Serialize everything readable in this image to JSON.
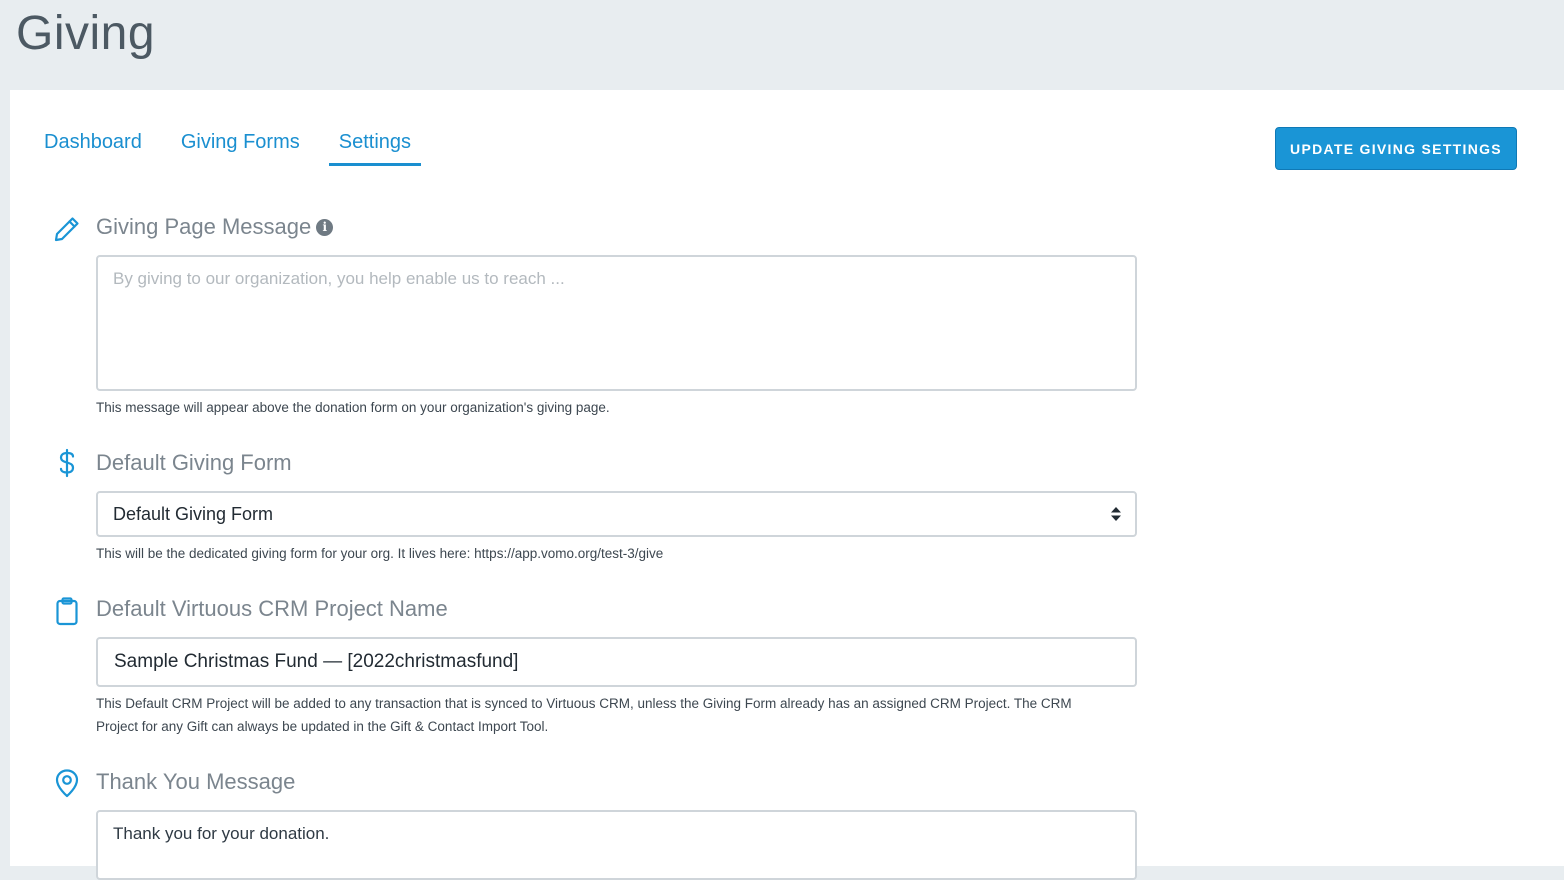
{
  "page": {
    "title": "Giving"
  },
  "tabs": [
    {
      "label": "Dashboard",
      "active": false
    },
    {
      "label": "Giving Forms",
      "active": false
    },
    {
      "label": "Settings",
      "active": true
    }
  ],
  "actions": {
    "update_label": "UPDATE GIVING SETTINGS"
  },
  "sections": {
    "message": {
      "label": "Giving Page Message",
      "icon": "pencil-icon",
      "placeholder": "By giving to our organization, you help enable us to reach ...",
      "value": "",
      "help": "This message will appear above the donation form on your organization's giving page."
    },
    "form": {
      "label": "Default Giving Form",
      "icon": "dollar-icon",
      "selected": "Default Giving Form",
      "help": "This will be the dedicated giving form for your org. It lives here: https://app.vomo.org/test-3/give"
    },
    "crm": {
      "label": "Default Virtuous CRM Project Name",
      "icon": "clipboard-icon",
      "value": "Sample Christmas Fund — [2022christmasfund]",
      "help": "This Default CRM Project will be added to any transaction that is synced to Virtuous CRM, unless the Giving Form already has an assigned CRM Project. The CRM Project for any Gift can always be updated in the Gift & Contact Import Tool."
    },
    "thanks": {
      "label": "Thank You Message",
      "icon": "map-pin-icon",
      "value": "Thank you for your donation."
    }
  },
  "colors": {
    "accent": "#1a95d6",
    "header_bg": "#e8edf0",
    "label": "#7b858e"
  }
}
